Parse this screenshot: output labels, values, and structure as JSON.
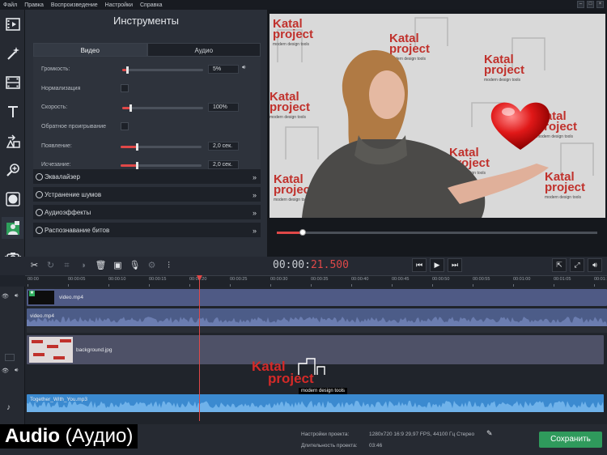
{
  "menu": [
    "Файл",
    "Правка",
    "Воспроизведение",
    "Настройки",
    "Справка"
  ],
  "tools": {
    "title": "Инструменты",
    "tabs": [
      "Видео",
      "Аудио"
    ],
    "volume_label": "Громкость:",
    "volume_value": "5%",
    "volume_level": 0.05,
    "normalize_label": "Нормализация",
    "speed_label": "Скорость:",
    "speed_value": "100%",
    "reverse_label": "Обратное проигрывание",
    "fadein_label": "Появление:",
    "fadein_value": "2,0 сек.",
    "fadeout_label": "Исчезание:",
    "fadeout_value": "2,0 сек.",
    "sections": [
      "Эквалайзер",
      "Устранение шумов",
      "Аудиоэффекты",
      "Распознавание битов"
    ]
  },
  "preview": {
    "watermark_word1": "Katal",
    "watermark_word2": "project",
    "watermark_tag": "modern design tools",
    "progress": 0.08
  },
  "timecode": {
    "main": "00:00:",
    "red": "21.500"
  },
  "ruler": [
    "00:00",
    "00:00:05",
    "00:00:10",
    "00:00:15",
    "00:00:20",
    "00:00:25",
    "00:00:30",
    "00:00:35",
    "00:00:40",
    "00:00:45",
    "00:00:50",
    "00:00:55",
    "00:01:00",
    "00:01:05",
    "00:01:10"
  ],
  "clips": {
    "video_name": "video.mp4",
    "video_audio_name": "video.mp4",
    "background_name": "background.jpg",
    "music_name": "Together_With_You.mp3"
  },
  "overlay_logo": {
    "word1": "Katal",
    "word2": "project",
    "tag": "modern design tools"
  },
  "caption": {
    "bold": "Audio",
    "rest": " (Аудио)"
  },
  "project": {
    "settings_label": "Настройки проекта:",
    "settings_value": "1280x720 16:9 29,97 FPS, 44100 Гц Стерео",
    "duration_label": "Длительность проекта:",
    "duration_value": "03:46"
  },
  "save_label": "Сохранить",
  "colors": {
    "accent": "#e04848",
    "save": "#2f9a5c",
    "video_track": "#4f5a85",
    "audio_track": "#3b8ad0"
  }
}
